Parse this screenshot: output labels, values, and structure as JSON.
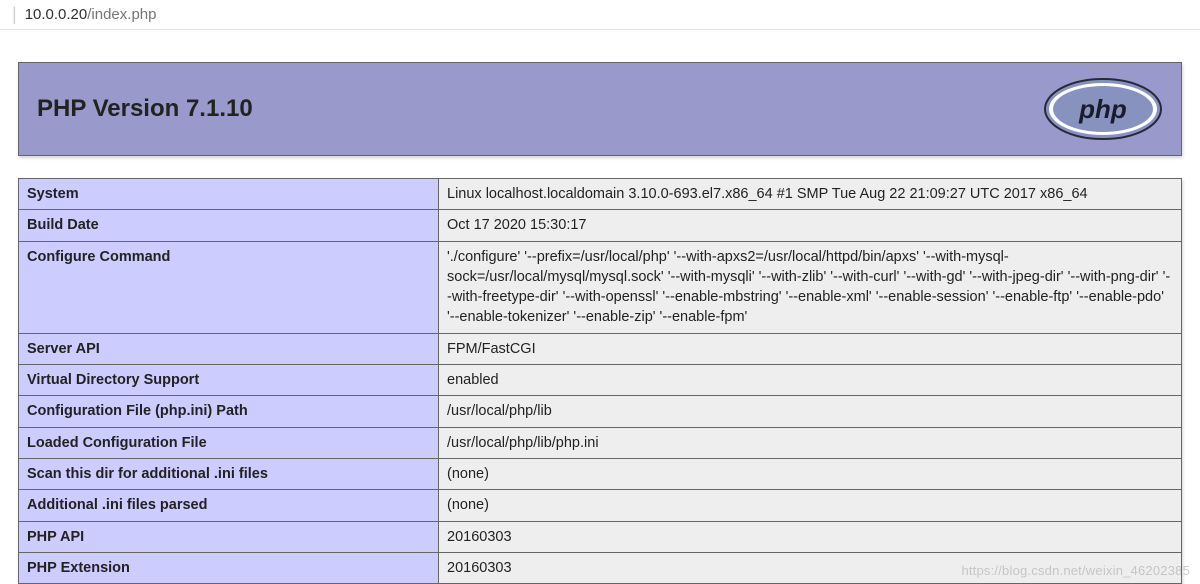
{
  "browser": {
    "url_host": "10.0.0.20",
    "url_path": "/index.php"
  },
  "header": {
    "title": "PHP Version 7.1.10"
  },
  "rows": [
    {
      "key": "System",
      "val": "Linux localhost.localdomain 3.10.0-693.el7.x86_64 #1 SMP Tue Aug 22 21:09:27 UTC 2017 x86_64"
    },
    {
      "key": "Build Date",
      "val": "Oct 17 2020 15:30:17"
    },
    {
      "key": "Configure Command",
      "val": "'./configure' '--prefix=/usr/local/php' '--with-apxs2=/usr/local/httpd/bin/apxs' '--with-mysql-sock=/usr/local/mysql/mysql.sock' '--with-mysqli' '--with-zlib' '--with-curl' '--with-gd' '--with-jpeg-dir' '--with-png-dir' '--with-freetype-dir' '--with-openssl' '--enable-mbstring' '--enable-xml' '--enable-session' '--enable-ftp' '--enable-pdo' '--enable-tokenizer' '--enable-zip' '--enable-fpm'"
    },
    {
      "key": "Server API",
      "val": "FPM/FastCGI"
    },
    {
      "key": "Virtual Directory Support",
      "val": "enabled"
    },
    {
      "key": "Configuration File (php.ini) Path",
      "val": "/usr/local/php/lib"
    },
    {
      "key": "Loaded Configuration File",
      "val": "/usr/local/php/lib/php.ini"
    },
    {
      "key": "Scan this dir for additional .ini files",
      "val": "(none)"
    },
    {
      "key": "Additional .ini files parsed",
      "val": "(none)"
    },
    {
      "key": "PHP API",
      "val": "20160303"
    },
    {
      "key": "PHP Extension",
      "val": "20160303"
    }
  ],
  "watermark": "https://blog.csdn.net/weixin_46202385"
}
